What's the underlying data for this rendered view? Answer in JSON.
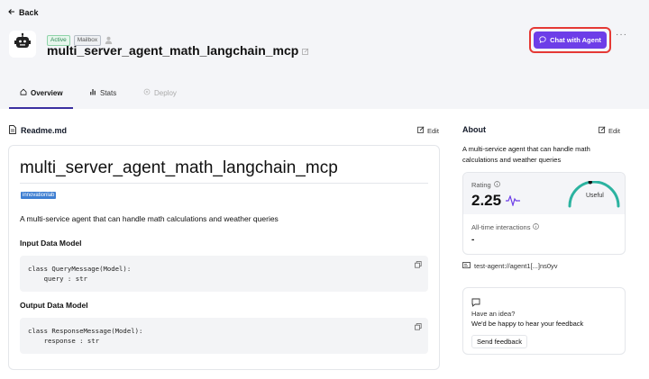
{
  "nav": {
    "back_label": "Back"
  },
  "agent": {
    "status_badge": "Active",
    "mailbox_badge": "Mailbox",
    "name": "multi_server_agent_math_langchain_mcp"
  },
  "actions": {
    "chat_label": "Chat with Agent",
    "more_label": "···"
  },
  "tabs": [
    {
      "label": "Overview"
    },
    {
      "label": "Stats"
    },
    {
      "label": "Deploy"
    }
  ],
  "readme": {
    "header": "Readme.md",
    "edit_label": "Edit",
    "title": "multi_server_agent_math_langchain_mcp",
    "tag": "innovationlab",
    "description": "A multi-service agent that can handle math calculations and weather queries",
    "input_heading": "Input Data Model",
    "input_code": "class QueryMessage(Model):\n    query : str",
    "output_heading": "Output Data Model",
    "output_code": "class ResponseMessage(Model):\n    response : str"
  },
  "about": {
    "header": "About",
    "edit_label": "Edit",
    "description": "A multi-service agent that can handle math calculations and weather queries",
    "rating_label": "Rating",
    "rating_value": "2.25",
    "rating_fraction": 0.45,
    "gauge_label": "Useful",
    "interactions_label": "All-time interactions",
    "interactions_value": "-",
    "address": "test-agent://agent1[...]ns0yv"
  },
  "idea": {
    "title": "Have an idea?",
    "subtitle": "We'd be happy to hear your feedback",
    "button_label": "Send feedback"
  },
  "colors": {
    "accent": "#6d3ee8",
    "highlight_outline": "#e53935",
    "tag": "#3f7fd2"
  }
}
